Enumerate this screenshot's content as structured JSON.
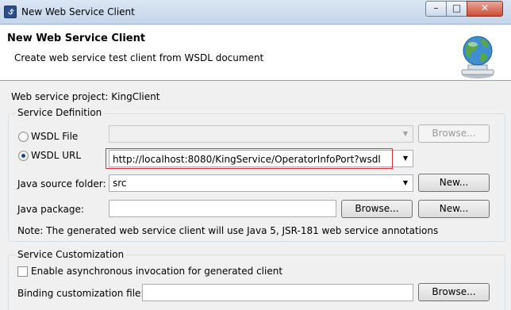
{
  "window": {
    "title": "New Web Service Client",
    "controls": {
      "minimize": "–",
      "maximize": "□",
      "close": "✕"
    }
  },
  "header": {
    "title": "New Web Service Client",
    "description": "Create web service test client from WSDL document",
    "icon": "globe-web-service-icon"
  },
  "project": {
    "label": "Web service project:",
    "value": "KingClient"
  },
  "service_definition": {
    "group_label": "Service Definition",
    "wsdl_file": {
      "label": "WSDL File",
      "selected": false,
      "value": "",
      "browse_label": "Browse..."
    },
    "wsdl_url": {
      "label": "WSDL URL",
      "selected": true,
      "value": "http://localhost:8080/KingService/OperatorInfoPort?wsdl"
    },
    "java_source_folder": {
      "label": "Java source folder:",
      "value": "src",
      "new_label": "New..."
    },
    "java_package": {
      "label": "Java package:",
      "value": "",
      "browse_label": "Browse...",
      "new_label": "New..."
    },
    "note": "Note: The generated web service client will use Java 5, JSR-181 web service annotations"
  },
  "service_customization": {
    "group_label": "Service Customization",
    "async_checkbox": {
      "label": "Enable asynchronous invocation for generated client",
      "checked": false
    },
    "binding_file": {
      "label": "Binding customization file:",
      "value": "",
      "browse_label": "Browse..."
    }
  },
  "colors": {
    "highlight_border": "#e0303a",
    "radio_selected": "#1b3f7a"
  }
}
